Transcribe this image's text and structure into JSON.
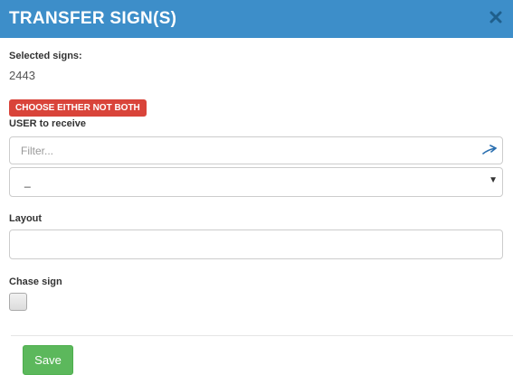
{
  "modal": {
    "title": "TRANSFER SIGN(S)",
    "close_icon": "close-icon",
    "header_color": "#3d8ec9"
  },
  "selected": {
    "label": "Selected signs:",
    "value": "2443"
  },
  "warning_badge": {
    "text": "CHOOSE EITHER NOT BOTH",
    "color": "#d9443a"
  },
  "user": {
    "label": "USER to receive",
    "filter_placeholder": "Filter...",
    "filter_icon": "filter-arrow-icon",
    "select_value": "_"
  },
  "layout": {
    "label": "Layout",
    "value": ""
  },
  "chase": {
    "label": "Chase sign",
    "checked": false
  },
  "footer": {
    "save_label": "Save",
    "save_color": "#5cb85c"
  }
}
